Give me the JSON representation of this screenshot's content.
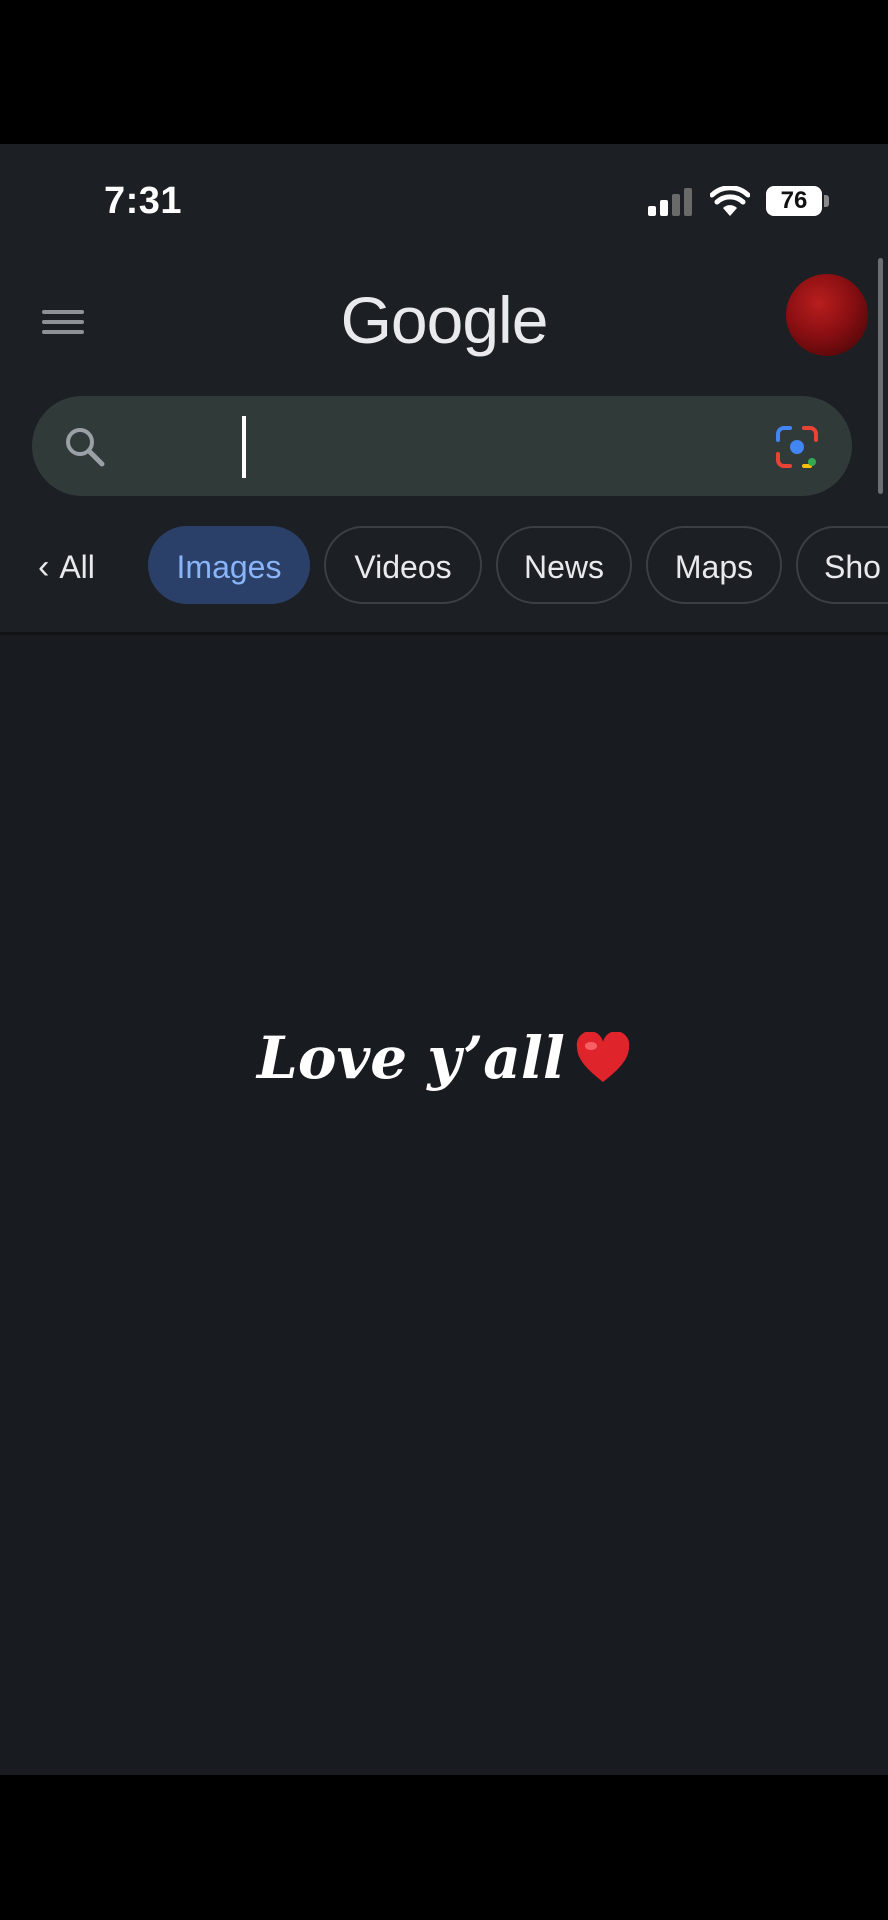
{
  "status_bar": {
    "time": "7:31",
    "battery": "76"
  },
  "app_bar": {
    "logo_text": "Google",
    "menu_icon": "hamburger-menu-icon",
    "avatar": "profile-avatar"
  },
  "search": {
    "value": "",
    "left_icon": "search-icon",
    "right_icon": "google-lens-icon"
  },
  "chips": {
    "back_label": "All",
    "items": [
      {
        "label": "Images",
        "active": true
      },
      {
        "label": "Videos",
        "active": false
      },
      {
        "label": "News",
        "active": false
      },
      {
        "label": "Maps",
        "active": false
      },
      {
        "label": "Sho",
        "active": false
      }
    ]
  },
  "overlay": {
    "caption": "Love y’all",
    "emoji": "heart-icon"
  },
  "colors": {
    "background": "#181b1f",
    "search_box": "#303a38",
    "active_chip_bg": "#2a4068",
    "active_chip_text": "#8ab4f8",
    "avatar": "#8a0f12"
  }
}
